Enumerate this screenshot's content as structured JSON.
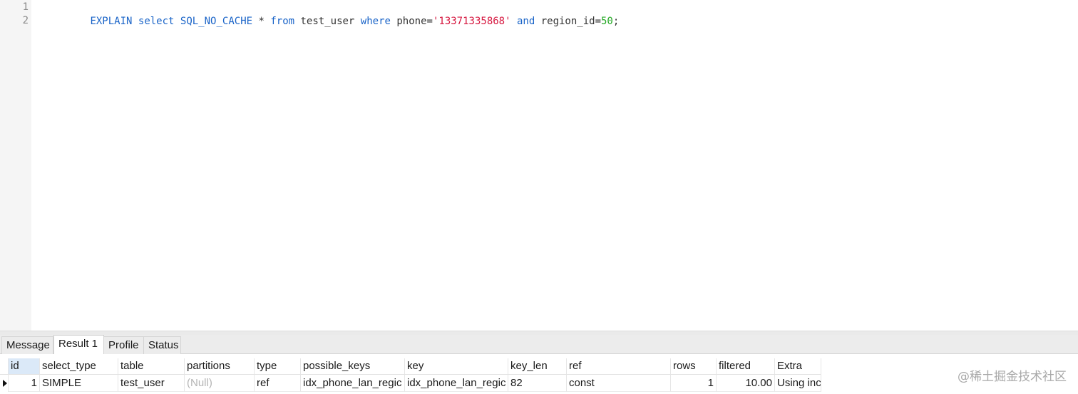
{
  "editor": {
    "line_numbers": [
      "1",
      "2"
    ],
    "query_tokens": [
      {
        "text": "EXPLAIN",
        "kind": "kw"
      },
      {
        "text": " ",
        "kind": "plain"
      },
      {
        "text": "select",
        "kind": "kw"
      },
      {
        "text": " ",
        "kind": "plain"
      },
      {
        "text": "SQL_NO_CACHE",
        "kind": "kw"
      },
      {
        "text": " * ",
        "kind": "plain"
      },
      {
        "text": "from",
        "kind": "kw"
      },
      {
        "text": " test_user ",
        "kind": "plain"
      },
      {
        "text": "where",
        "kind": "kw"
      },
      {
        "text": " phone=",
        "kind": "plain"
      },
      {
        "text": "'13371335868'",
        "kind": "str"
      },
      {
        "text": " ",
        "kind": "plain"
      },
      {
        "text": "and",
        "kind": "kw"
      },
      {
        "text": " region_id=",
        "kind": "plain"
      },
      {
        "text": "50",
        "kind": "num"
      },
      {
        "text": ";",
        "kind": "plain"
      }
    ]
  },
  "tabs": {
    "message": "Message",
    "result": "Result 1",
    "profile": "Profile",
    "status": "Status",
    "active": "result"
  },
  "grid": {
    "columns": {
      "id": "id",
      "select_type": "select_type",
      "table": "table",
      "partitions": "partitions",
      "type": "type",
      "possible_keys": "possible_keys",
      "key": "key",
      "key_len": "key_len",
      "ref": "ref",
      "rows": "rows",
      "filtered": "filtered",
      "extra": "Extra"
    },
    "selected_column": "id",
    "row": {
      "id": "1",
      "select_type": "SIMPLE",
      "table": "test_user",
      "partitions": "(Null)",
      "type": "ref",
      "possible_keys": "idx_phone_lan_regic",
      "key": "idx_phone_lan_regic",
      "key_len": "82",
      "ref": "const",
      "rows": "1",
      "filtered": "10.00",
      "extra": "Using inc"
    }
  },
  "watermark": "@稀土掘金技术社区",
  "colors": {
    "keyword": "#1a64c8",
    "string": "#d6173f",
    "number": "#24a824",
    "header_selected": "#dbe9f8",
    "null_text": "#b4b4b4"
  }
}
